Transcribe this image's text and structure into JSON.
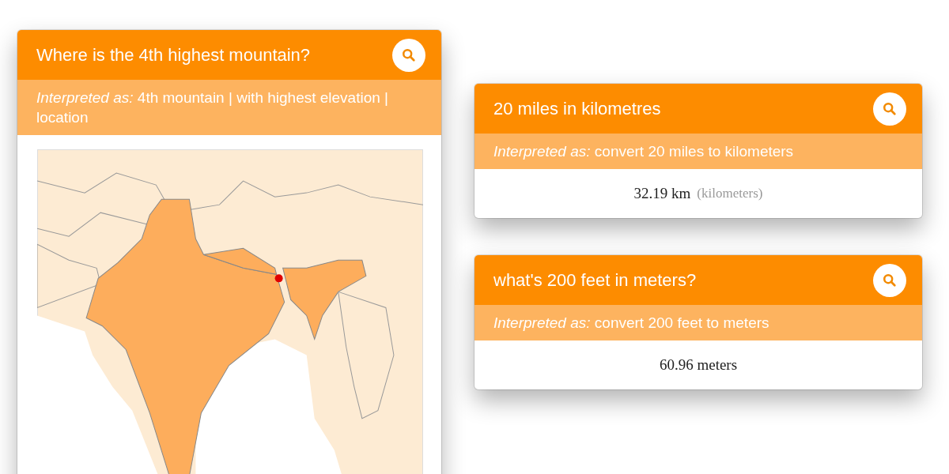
{
  "cards": [
    {
      "query": "Where is the 4th highest mountain?",
      "interpretation": "*Interpreted as:* 4th mountain | with highest elevation | location",
      "result": {
        "kind": "map"
      }
    },
    {
      "query": "20 miles in kilometres",
      "interpretation": "*Interpreted as:* convert 20 miles to kilometers",
      "result": {
        "kind": "value",
        "value": "32.19 km",
        "note": "(kilometers)"
      }
    },
    {
      "query": "what's 200 feet in meters?",
      "interpretation": "*Interpreted as:* convert 200 feet to meters",
      "result": {
        "kind": "value",
        "value": "60.96 meters"
      }
    }
  ]
}
